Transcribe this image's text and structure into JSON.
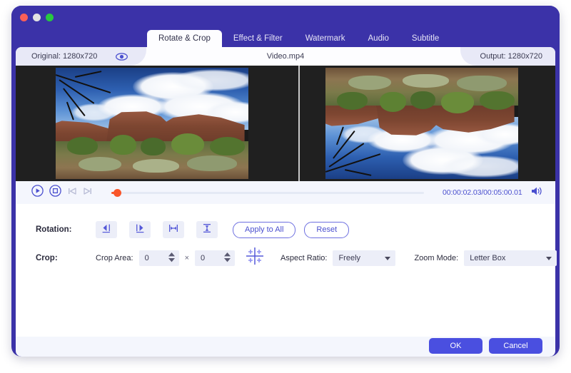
{
  "window": {
    "traffic_lights": [
      "close",
      "minimize",
      "zoom"
    ],
    "accent": "#4a4fe0",
    "titlebar_color": "#3b32a8"
  },
  "tabs": [
    {
      "label": "Rotate & Crop",
      "active": true
    },
    {
      "label": "Effect & Filter",
      "active": false
    },
    {
      "label": "Watermark",
      "active": false
    },
    {
      "label": "Audio",
      "active": false
    },
    {
      "label": "Subtitle",
      "active": false
    }
  ],
  "infobar": {
    "original_label": "Original: 1280x720",
    "eye_icon": "eye-icon",
    "filename": "Video.mp4",
    "output_label": "Output: 1280x720"
  },
  "preview": {
    "left_pane_name": "original-preview",
    "right_pane_name": "output-preview",
    "right_pane_transform": "flip-vertical"
  },
  "player": {
    "play_icon": "play-circle-icon",
    "stop_icon": "stop-circle-icon",
    "prev_icon": "skip-previous-icon",
    "next_icon": "skip-next-icon",
    "progress_percent": 0.7,
    "timecode": "00:00:02.03/00:05:00.01",
    "volume_icon": "volume-icon"
  },
  "rotation": {
    "label": "Rotation:",
    "buttons": [
      {
        "name": "rotate-left-button",
        "icon": "rotate-left-icon"
      },
      {
        "name": "rotate-right-button",
        "icon": "rotate-right-icon"
      },
      {
        "name": "flip-horizontal-button",
        "icon": "flip-horizontal-icon"
      },
      {
        "name": "flip-vertical-button",
        "icon": "flip-vertical-icon"
      }
    ],
    "apply_to_all_label": "Apply to All",
    "reset_label": "Reset"
  },
  "crop": {
    "label": "Crop:",
    "crop_area_label": "Crop Area:",
    "width_value": "0",
    "height_value": "0",
    "separator": "×",
    "crop_tool_icon": "crop-target-icon",
    "aspect_ratio_label": "Aspect Ratio:",
    "aspect_ratio_value": "Freely",
    "zoom_mode_label": "Zoom Mode:",
    "zoom_mode_value": "Letter Box"
  },
  "footer": {
    "ok_label": "OK",
    "cancel_label": "Cancel"
  }
}
